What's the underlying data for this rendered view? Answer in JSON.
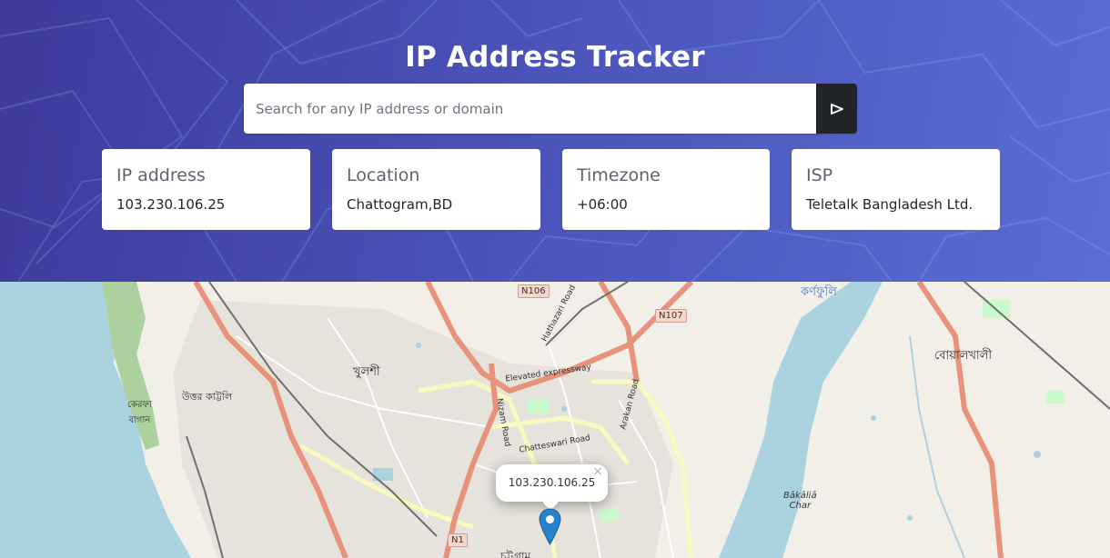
{
  "header": {
    "title": "IP Address Tracker",
    "search": {
      "placeholder": "Search for any IP address or domain",
      "value": "",
      "button_icon": "submit-arrow-icon"
    }
  },
  "cards": {
    "ip": {
      "label": "IP address",
      "value": "103.230.106.25"
    },
    "location": {
      "label": "Location",
      "value": "Chattogram,BD"
    },
    "timezone": {
      "label": "Timezone",
      "value": "+06:00"
    },
    "isp": {
      "label": "ISP",
      "value": "Teletalk Bangladesh Ltd."
    }
  },
  "map": {
    "popup_text": "103.230.106.25",
    "popup_close": "×",
    "shields": {
      "n106": "N106",
      "n107": "N107",
      "n1": "N1"
    },
    "labels": {
      "karnaphuli": "কর্ণফুলি",
      "boalkhali": "বোয়ালখালী",
      "khulshi": "খুলশী",
      "uttar_kattali": "উত্তর কাট্টলি",
      "kerafa_bagan": "কেরফা\nবাগান",
      "bakalia_char": "Bākāliā\nChar",
      "chatteswari_road": "Chatteswari Road",
      "elevated_expressway": "Elevated expressway",
      "hathazari_road": "Hathazari Road",
      "nizam_road": "Nizam Road",
      "arakan_road": "Arakan Road",
      "chattogram": "চট্টগ্রাম"
    }
  },
  "colors": {
    "header_start": "#3f3a9c",
    "header_end": "#5a6ed6",
    "button_bg": "#212529",
    "water": "#aad3df",
    "land": "#f2efe9",
    "primary_road": "#e8927c",
    "secondary_road": "#f7fabf",
    "marker": "#2a81cb"
  }
}
